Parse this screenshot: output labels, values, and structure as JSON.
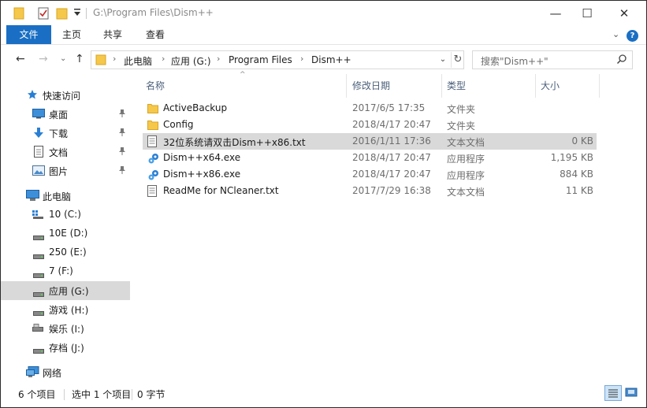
{
  "window": {
    "title_path": "G:\\Program Files\\Dism++",
    "minimize_symbol": "—",
    "maximize_symbol": "☐",
    "close_symbol": "✕"
  },
  "ribbon": {
    "tabs": [
      {
        "label": "文件"
      },
      {
        "label": "主页"
      },
      {
        "label": "共享"
      },
      {
        "label": "查看"
      }
    ],
    "expand_symbol": "⌄",
    "help_symbol": "?"
  },
  "address": {
    "back_symbol": "←",
    "forward_symbol": "→",
    "recent_symbol": "⌄",
    "up_symbol": "↑",
    "crumbs": [
      "此电脑",
      "应用 (G:)",
      "Program Files",
      "Dism++"
    ],
    "crumb_separator": "›",
    "dropdown_symbol": "⌄",
    "refresh_symbol": "↻",
    "search_placeholder": "搜索\"Dism++\""
  },
  "nav": {
    "quick_access": "快速访问",
    "quick_items": [
      {
        "label": "桌面"
      },
      {
        "label": "下载"
      },
      {
        "label": "文档"
      },
      {
        "label": "图片"
      }
    ],
    "this_pc": "此电脑",
    "drives": [
      {
        "label": "10 (C:)"
      },
      {
        "label": "10E (D:)"
      },
      {
        "label": "250 (E:)"
      },
      {
        "label": "7 (F:)"
      },
      {
        "label": "应用 (G:)"
      },
      {
        "label": "游戏 (H:)"
      },
      {
        "label": "娱乐 (I:)"
      },
      {
        "label": "存档 (J:)"
      }
    ],
    "network": "网络",
    "selected_drive_index": 4
  },
  "columns": {
    "name": "名称",
    "date": "修改日期",
    "type": "类型",
    "size": "大小",
    "sort_symbol": "^"
  },
  "files": [
    {
      "name": "ActiveBackup",
      "date": "2017/6/5 17:35",
      "type": "文件夹",
      "size": "",
      "icon": "folder-icon"
    },
    {
      "name": "Config",
      "date": "2018/4/17 20:47",
      "type": "文件夹",
      "size": "",
      "icon": "folder-icon"
    },
    {
      "name": "32位系统请双击Dism++x86.txt",
      "date": "2016/1/11 17:36",
      "type": "文本文档",
      "size": "0 KB",
      "icon": "text-file-icon"
    },
    {
      "name": "Dism++x64.exe",
      "date": "2018/4/17 20:47",
      "type": "应用程序",
      "size": "1,195 KB",
      "icon": "gear-exe-icon"
    },
    {
      "name": "Dism++x86.exe",
      "date": "2018/4/17 20:47",
      "type": "应用程序",
      "size": "884 KB",
      "icon": "gear-exe-icon"
    },
    {
      "name": "ReadMe for NCleaner.txt",
      "date": "2017/7/29 16:38",
      "type": "文本文档",
      "size": "11 KB",
      "icon": "text-file-icon"
    }
  ],
  "selected_file_index": 2,
  "status": {
    "count": "6 个项目",
    "selected": "选中 1 个项目",
    "size": "0 字节"
  },
  "colors": {
    "accent": "#1a6fc4",
    "selection": "#d9d9d9",
    "folder": "#f5c84c"
  }
}
